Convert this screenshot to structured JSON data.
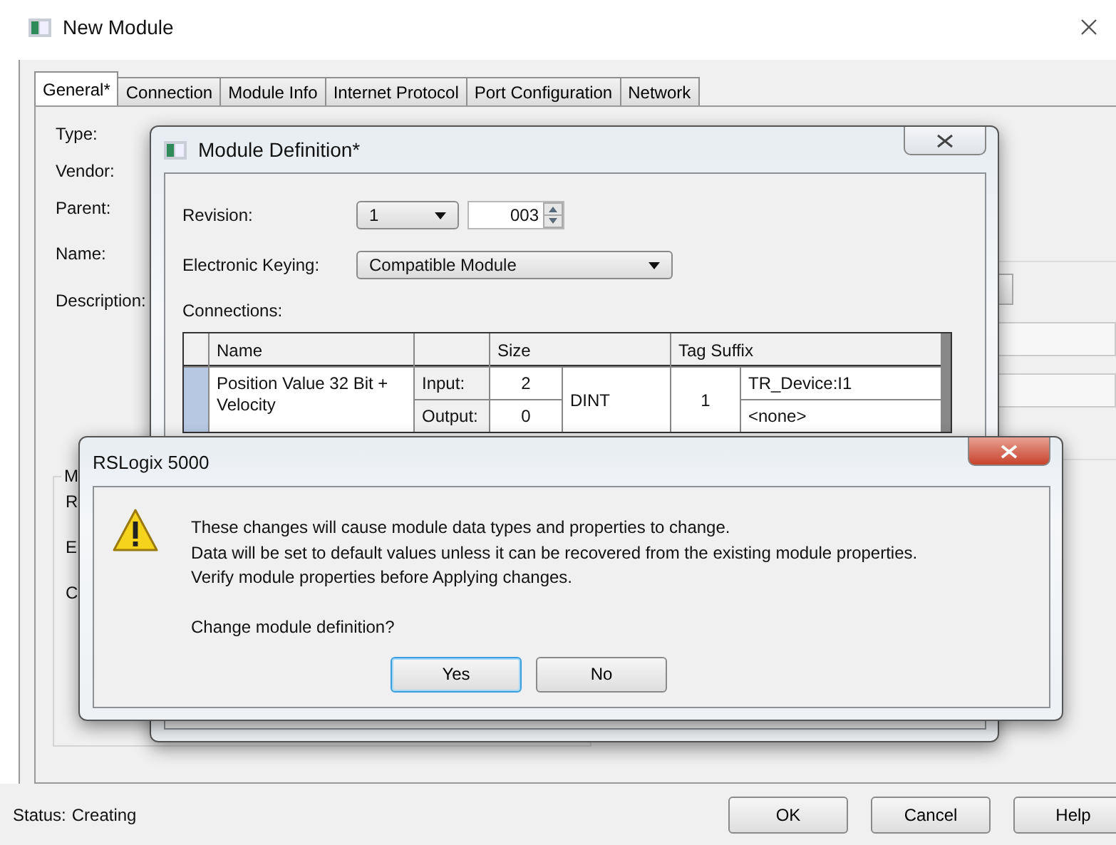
{
  "window": {
    "title": "New Module"
  },
  "tabs": [
    {
      "label": "General*",
      "selected": true
    },
    {
      "label": "Connection",
      "selected": false
    },
    {
      "label": "Module Info",
      "selected": false
    },
    {
      "label": "Internet Protocol",
      "selected": false
    },
    {
      "label": "Port Configuration",
      "selected": false
    },
    {
      "label": "Network",
      "selected": false
    }
  ],
  "general": {
    "labels": [
      "Type:",
      "Vendor:",
      "Parent:",
      "Name:",
      "Description:"
    ],
    "group_label": "M",
    "group_rows": [
      "R",
      "E",
      "C"
    ]
  },
  "module_definition": {
    "title": "Module Definition*",
    "revision_label": "Revision:",
    "revision_major": "1",
    "revision_minor": "003",
    "keying_label": "Electronic Keying:",
    "keying_value": "Compatible Module",
    "connections_label": "Connections:",
    "columns": [
      {
        "label": "Name"
      },
      {
        "label": "Size"
      },
      {
        "label": "Tag Suffix"
      }
    ],
    "rows": [
      {
        "name": "Position Value 32 Bit + Velocity",
        "selected": true,
        "input_label": "Input:",
        "input_size": "2",
        "output_label": "Output:",
        "output_size": "0",
        "data_type": "DINT",
        "tag_count": "1",
        "input_tag": "TR_Device:I1",
        "output_tag": "<none>"
      }
    ]
  },
  "alert": {
    "title": "RSLogix 5000",
    "lines": [
      "These changes will cause module data types and properties to change.",
      "Data will be set to default values unless it can be recovered from the existing module properties.",
      "Verify module properties before Applying changes."
    ],
    "question": "Change module definition?",
    "buttons": [
      {
        "label": "Yes",
        "focused": true
      },
      {
        "label": "No",
        "focused": false
      }
    ]
  },
  "status": {
    "label": "Status:",
    "value": "Creating"
  },
  "buttons": [
    "OK",
    "Cancel",
    "Help"
  ]
}
